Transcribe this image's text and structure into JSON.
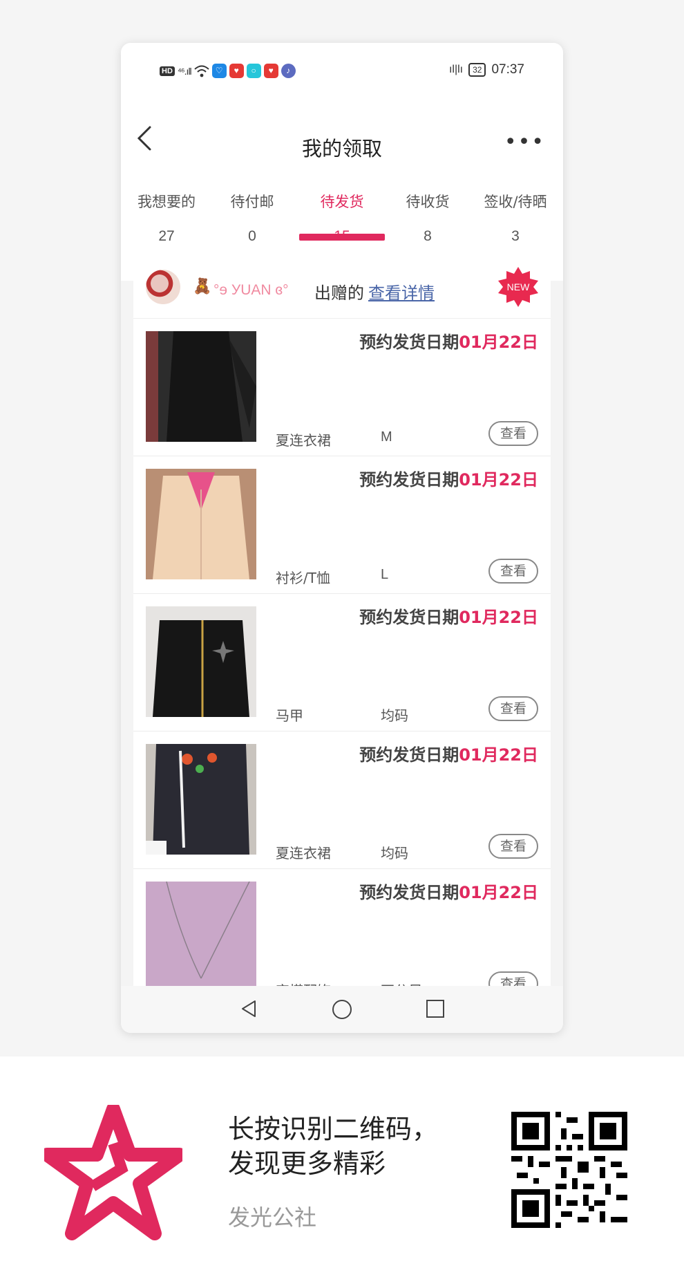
{
  "status_bar": {
    "left_icons": [
      "hd-icon",
      "4g-signal-icon",
      "wifi-icon",
      "app-icon-blue",
      "app-icon-red",
      "app-icon-cyan",
      "app-icon-red-2",
      "app-icon-music"
    ],
    "time": "07:37",
    "battery": "32"
  },
  "header": {
    "title": "我的领取"
  },
  "tabs": [
    {
      "label": "我想要的",
      "count": "27"
    },
    {
      "label": "待付邮",
      "count": "0"
    },
    {
      "label": "待发货",
      "count": "15",
      "active": true
    },
    {
      "label": "待收货",
      "count": "8"
    },
    {
      "label": "签收/待晒",
      "count": "3"
    }
  ],
  "donor": {
    "name": "°ɘ УUAN ɞ°",
    "action": "出赠的",
    "detail_link": "查看详情",
    "badge": "NEW"
  },
  "items": [
    {
      "ship_prefix": "预约发货日期",
      "ship_date": "01月22日",
      "category": "夏连衣裙",
      "size": "M",
      "button": "查看"
    },
    {
      "ship_prefix": "预约发货日期",
      "ship_date": "01月22日",
      "category": "衬衫/T恤",
      "size": "L",
      "button": "查看"
    },
    {
      "ship_prefix": "预约发货日期",
      "ship_date": "01月22日",
      "category": "马甲",
      "size": "均码",
      "button": "查看"
    },
    {
      "ship_prefix": "预约发货日期",
      "ship_date": "01月22日",
      "category": "夏连衣裙",
      "size": "均码",
      "button": "查看"
    },
    {
      "ship_prefix": "预约发货日期",
      "ship_date": "01月22日",
      "category": "穿搭配饰",
      "size": "不分尺",
      "button": "查看"
    }
  ],
  "footer": {
    "line1": "长按识别二维码，",
    "line2": "发现更多精彩",
    "brand": "发光公社"
  },
  "colors": {
    "accent": "#e0295e",
    "link": "#4a66a8"
  }
}
